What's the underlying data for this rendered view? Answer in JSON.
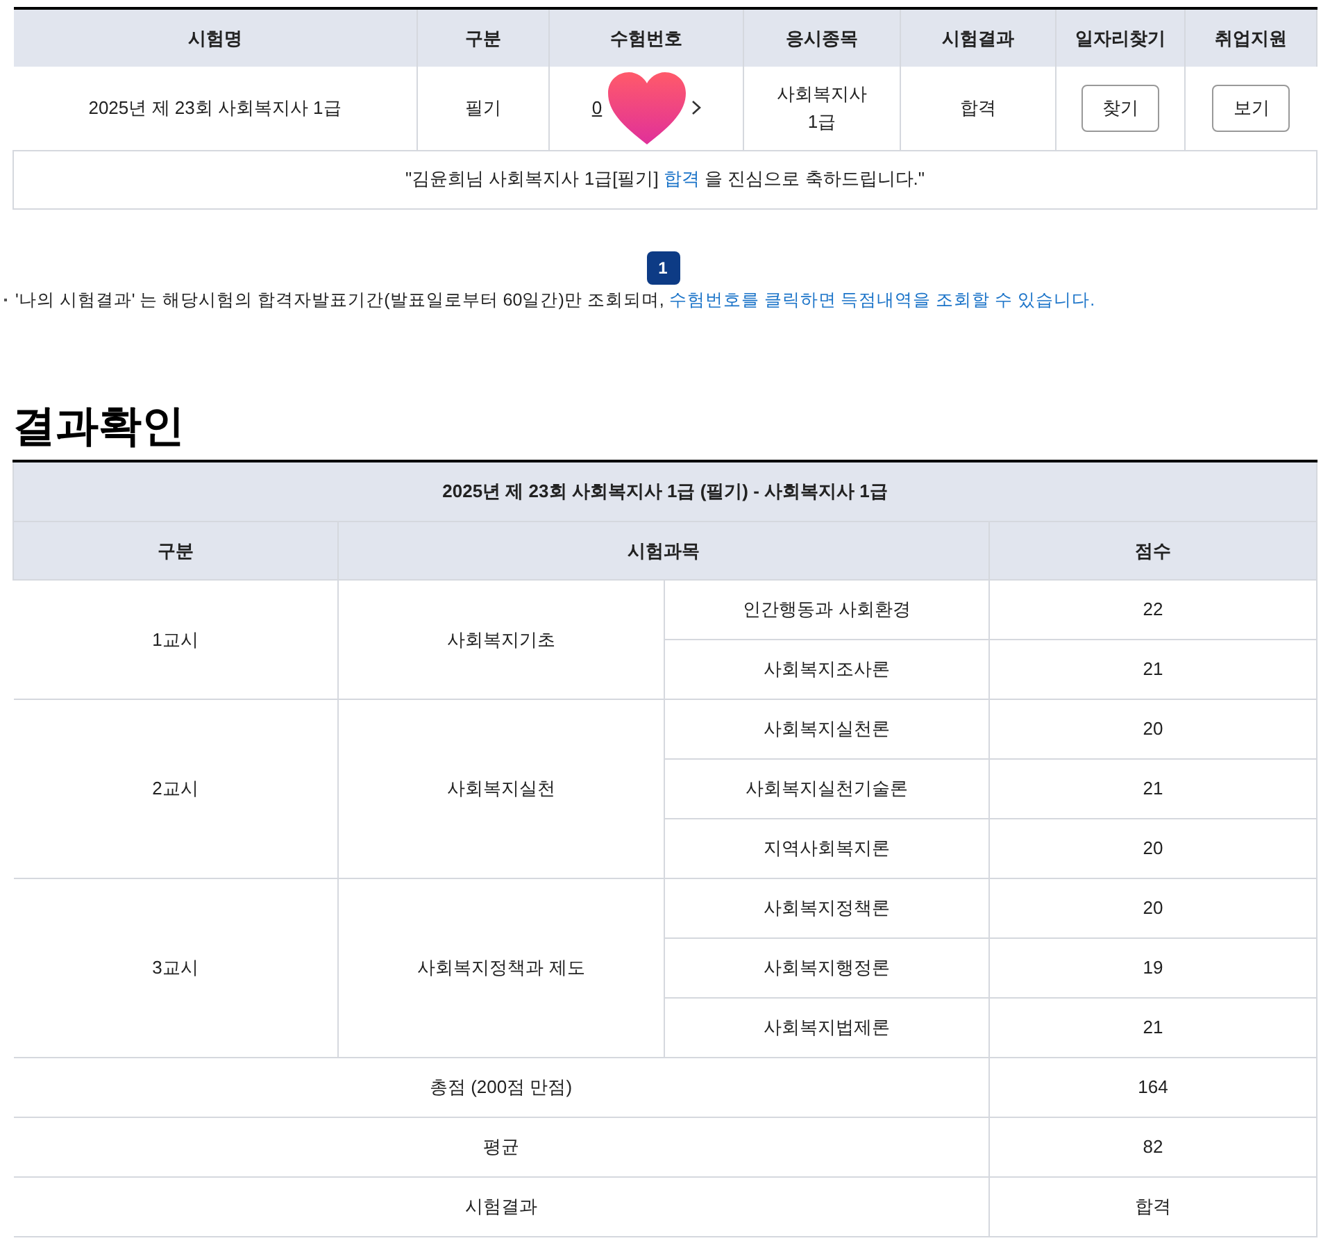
{
  "results_table": {
    "columns": [
      "시험명",
      "구분",
      "수험번호",
      "응시종목",
      "시험결과",
      "일자리찾기",
      "취업지원"
    ],
    "row": {
      "exam_name": "2025년 제 23회 사회복지사 1급",
      "type": "필기",
      "exam_number": "0",
      "field": "사회복지사 1급",
      "result": "합격",
      "find_button": "찾기",
      "support_button": "보기"
    },
    "message": "\"김윤희님 사회복지사 1급[필기] ",
    "message_link": "합격",
    "message_end": " 을 진심으로 축하드립니다.\""
  },
  "pagination": [
    {
      "label": "1",
      "selected": true
    }
  ],
  "note": {
    "text": "'나의 시험결과' 는 해당시험의 합격자발표기간(발표일로부터 60일간)만 조회되며, ",
    "highlight": "수험번호를 클릭하면 득점내역을 조회할 수 있습니다."
  },
  "section_title": "결과확인",
  "score_table": {
    "title": "2025년 제 23회 사회복지사 1급 (필기) - 사회복지사 1급",
    "columns": [
      "구분",
      "시험과목",
      "점수"
    ],
    "periods": [
      {
        "name": "1교시",
        "area": "사회복지기초",
        "subjects": [
          {
            "name": "인간행동과 사회환경",
            "score": "22"
          },
          {
            "name": "사회복지조사론",
            "score": "21"
          }
        ]
      },
      {
        "name": "2교시",
        "area": "사회복지실천",
        "subjects": [
          {
            "name": "사회복지실천론",
            "score": "20"
          },
          {
            "name": "사회복지실천기술론",
            "score": "21"
          },
          {
            "name": "지역사회복지론",
            "score": "20"
          }
        ]
      },
      {
        "name": "3교시",
        "area": "사회복지정책과 제도",
        "subjects": [
          {
            "name": "사회복지정책론",
            "score": "20"
          },
          {
            "name": "사회복지행정론",
            "score": "19"
          },
          {
            "name": "사회복지법제론",
            "score": "21"
          }
        ]
      }
    ],
    "totals": [
      {
        "label": "총점 (200점 만점)",
        "value": "164"
      },
      {
        "label": "평균",
        "value": "82"
      },
      {
        "label": "시험결과",
        "value": "합격"
      }
    ]
  }
}
